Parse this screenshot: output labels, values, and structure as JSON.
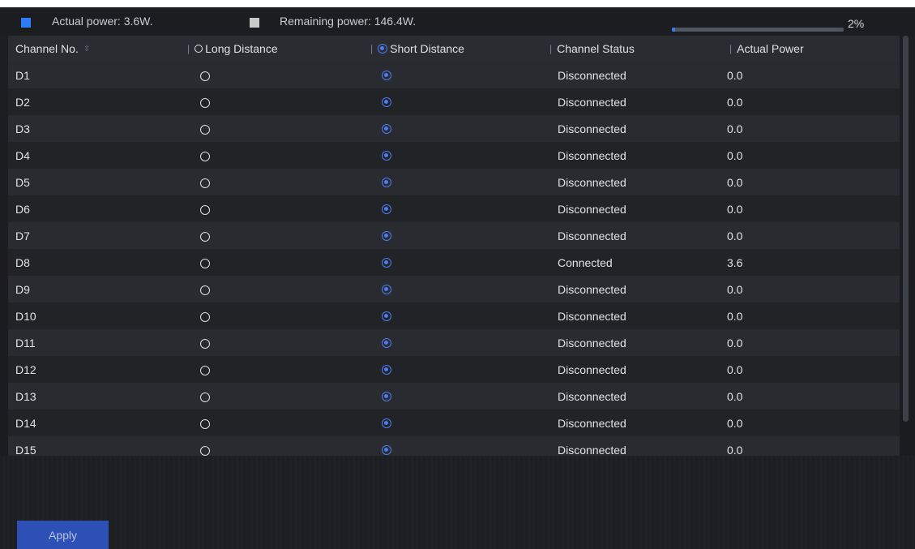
{
  "summary": {
    "actual_power_label": "Actual power: 3.6W.",
    "remaining_power_label": "Remaining power: 146.4W.",
    "usage_percent_text": "2%",
    "usage_fraction": 0.02,
    "actual_color": "#2f7df6",
    "remaining_color": "#c9c9c9"
  },
  "table": {
    "headers": {
      "channel": "Channel No.",
      "long_distance": "Long Distance",
      "short_distance": "Short Distance",
      "status": "Channel Status",
      "power": "Actual Power"
    },
    "rows": [
      {
        "channel": "D1",
        "mode": "short",
        "status": "Disconnected",
        "power": "0.0"
      },
      {
        "channel": "D2",
        "mode": "short",
        "status": "Disconnected",
        "power": "0.0"
      },
      {
        "channel": "D3",
        "mode": "short",
        "status": "Disconnected",
        "power": "0.0"
      },
      {
        "channel": "D4",
        "mode": "short",
        "status": "Disconnected",
        "power": "0.0"
      },
      {
        "channel": "D5",
        "mode": "short",
        "status": "Disconnected",
        "power": "0.0"
      },
      {
        "channel": "D6",
        "mode": "short",
        "status": "Disconnected",
        "power": "0.0"
      },
      {
        "channel": "D7",
        "mode": "short",
        "status": "Disconnected",
        "power": "0.0"
      },
      {
        "channel": "D8",
        "mode": "short",
        "status": "Connected",
        "power": "3.6"
      },
      {
        "channel": "D9",
        "mode": "short",
        "status": "Disconnected",
        "power": "0.0"
      },
      {
        "channel": "D10",
        "mode": "short",
        "status": "Disconnected",
        "power": "0.0"
      },
      {
        "channel": "D11",
        "mode": "short",
        "status": "Disconnected",
        "power": "0.0"
      },
      {
        "channel": "D12",
        "mode": "short",
        "status": "Disconnected",
        "power": "0.0"
      },
      {
        "channel": "D13",
        "mode": "short",
        "status": "Disconnected",
        "power": "0.0"
      },
      {
        "channel": "D14",
        "mode": "short",
        "status": "Disconnected",
        "power": "0.0"
      },
      {
        "channel": "D15",
        "mode": "short",
        "status": "Disconnected",
        "power": "0.0"
      }
    ]
  },
  "actions": {
    "apply_label": "Apply"
  }
}
